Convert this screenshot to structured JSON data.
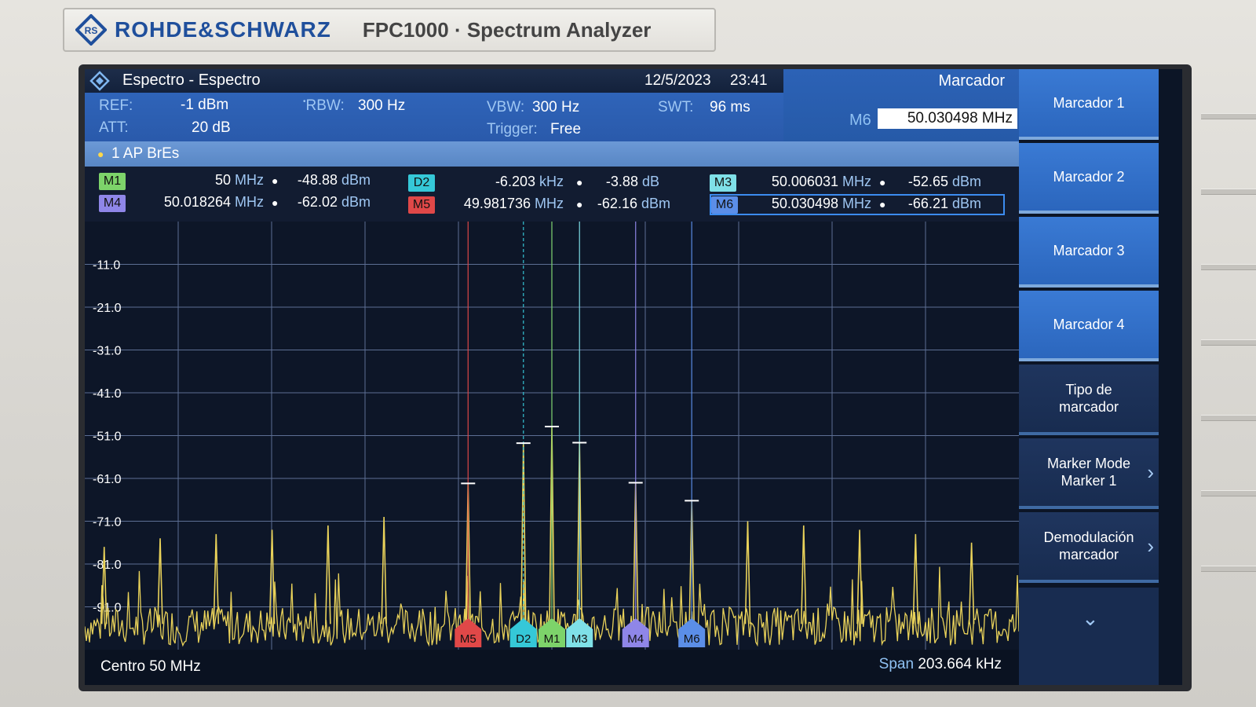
{
  "device": {
    "brand": "ROHDE&SCHWARZ",
    "model": "FPC1000 · Spectrum Analyzer"
  },
  "title_bar": {
    "title": "Espectro - Espectro",
    "date": "12/5/2023",
    "time": "23:41"
  },
  "params": {
    "ref_label": "REF:",
    "ref_value": "-1 dBm",
    "att_label": "ATT:",
    "att_value": "20 dB",
    "rbw_label": "RBW:",
    "rbw_value": "300 Hz",
    "vbw_label": "VBW:",
    "vbw_value": "300 Hz",
    "trigger_label": "Trigger:",
    "trigger_value": "Free",
    "swt_label": "SWT:",
    "swt_value": "96 ms"
  },
  "menu": {
    "title": "Marcador",
    "active_marker_label": "M6",
    "active_marker_value": "50.030498 MHz"
  },
  "trace": {
    "label": "1 AP  BrEs"
  },
  "markers": [
    {
      "id": "M1",
      "freq": "50",
      "freq_unit": "MHz",
      "level": "-48.88",
      "level_unit": "dBm",
      "color": "#7dd36a"
    },
    {
      "id": "D2",
      "freq": "-6.203",
      "freq_unit": "kHz",
      "level": "-3.88",
      "level_unit": "dB",
      "color": "#35c8d8"
    },
    {
      "id": "M3",
      "freq": "50.006031",
      "freq_unit": "MHz",
      "level": "-52.65",
      "level_unit": "dBm",
      "color": "#7fe0e8"
    },
    {
      "id": "M4",
      "freq": "50.018264",
      "freq_unit": "MHz",
      "level": "-62.02",
      "level_unit": "dBm",
      "color": "#8f86e8"
    },
    {
      "id": "M5",
      "freq": "49.981736",
      "freq_unit": "MHz",
      "level": "-62.16",
      "level_unit": "dBm",
      "color": "#e04848"
    },
    {
      "id": "M6",
      "freq": "50.030498",
      "freq_unit": "MHz",
      "level": "-66.21",
      "level_unit": "dBm",
      "color": "#5b8ee8"
    }
  ],
  "plot": {
    "y_ticks": [
      "-11.0",
      "-21.0",
      "-31.0",
      "-41.0",
      "-51.0",
      "-61.0",
      "-71.0",
      "-81.0",
      "-91.0"
    ],
    "center": "Centro 50 MHz",
    "span_key": "Span",
    "span_value": "203.664 kHz"
  },
  "chart_data": {
    "type": "line",
    "xlabel": "",
    "ylabel": "",
    "x_unit": "MHz",
    "y_unit": "dBm",
    "xlim": [
      49.898168,
      50.101832
    ],
    "ylim": [
      -101,
      -1
    ],
    "grid": true,
    "series": [
      {
        "name": "1 AP BrEs",
        "color": "#e9d25a",
        "noise_floor": -98,
        "peaks": [
          {
            "x": 49.9024,
            "y": -77
          },
          {
            "x": 49.9146,
            "y": -75
          },
          {
            "x": 49.9268,
            "y": -74
          },
          {
            "x": 49.939,
            "y": -73
          },
          {
            "x": 49.9512,
            "y": -72
          },
          {
            "x": 49.9634,
            "y": -70
          },
          {
            "x": 49.981736,
            "y": -62.16
          },
          {
            "x": 49.993797,
            "y": -52.76
          },
          {
            "x": 50.0,
            "y": -48.88
          },
          {
            "x": 50.006031,
            "y": -52.65
          },
          {
            "x": 50.018264,
            "y": -62.02
          },
          {
            "x": 50.030498,
            "y": -66.21
          },
          {
            "x": 50.0427,
            "y": -71
          },
          {
            "x": 50.0549,
            "y": -72
          },
          {
            "x": 50.0671,
            "y": -73
          },
          {
            "x": 50.0793,
            "y": -74
          },
          {
            "x": 50.0915,
            "y": -76
          }
        ]
      }
    ],
    "markers": [
      {
        "id": "M5",
        "x": 49.981736,
        "y": -62.16
      },
      {
        "id": "D2",
        "x": 49.993797,
        "y": -52.76
      },
      {
        "id": "M1",
        "x": 50.0,
        "y": -48.88
      },
      {
        "id": "M3",
        "x": 50.006031,
        "y": -52.65
      },
      {
        "id": "M4",
        "x": 50.018264,
        "y": -62.02
      },
      {
        "id": "M6",
        "x": 50.030498,
        "y": -66.21
      }
    ]
  },
  "softkeys": [
    {
      "label": "Marcador 1",
      "style": "blue",
      "chevron": false
    },
    {
      "label": "Marcador 2",
      "style": "blue",
      "chevron": false
    },
    {
      "label": "Marcador 3",
      "style": "blue",
      "chevron": false
    },
    {
      "label": "Marcador 4",
      "style": "blue",
      "chevron": false
    },
    {
      "label": "Tipo de\nmarcador",
      "style": "dark",
      "chevron": false
    },
    {
      "label": "Marker Mode\nMarker 1",
      "style": "dark",
      "chevron": true
    },
    {
      "label": "Demodulación\nmarcador",
      "style": "dark",
      "chevron": true
    }
  ],
  "icons": {
    "more": "chevron-down-icon",
    "submenu": "chevron-right-icon",
    "logo": "rs-diamond-logo"
  }
}
